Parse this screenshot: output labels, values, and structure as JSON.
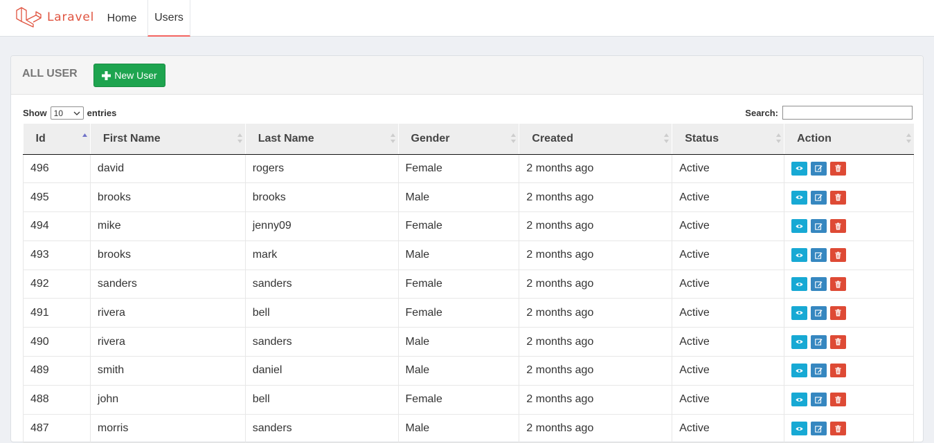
{
  "navbar": {
    "brand": "Laravel",
    "items": [
      {
        "label": "Home",
        "active": false
      },
      {
        "label": "Users",
        "active": true
      }
    ]
  },
  "panel": {
    "title": "ALL USER",
    "new_button": "New User"
  },
  "table_controls": {
    "show_label": "Show",
    "entries_value": "10",
    "entries_label": "entries",
    "search_label": "Search:",
    "search_value": ""
  },
  "table": {
    "columns": [
      "Id",
      "First Name",
      "Last Name",
      "Gender",
      "Created",
      "Status",
      "Action"
    ],
    "sorted_column": "Id",
    "rows": [
      {
        "id": "496",
        "first": "david",
        "last": "rogers",
        "gender": "Female",
        "created": "2 months ago",
        "status": "Active"
      },
      {
        "id": "495",
        "first": "brooks",
        "last": "brooks",
        "gender": "Male",
        "created": "2 months ago",
        "status": "Active"
      },
      {
        "id": "494",
        "first": "mike",
        "last": "jenny09",
        "gender": "Female",
        "created": "2 months ago",
        "status": "Active"
      },
      {
        "id": "493",
        "first": "brooks",
        "last": "mark",
        "gender": "Male",
        "created": "2 months ago",
        "status": "Active"
      },
      {
        "id": "492",
        "first": "sanders",
        "last": "sanders",
        "gender": "Female",
        "created": "2 months ago",
        "status": "Active"
      },
      {
        "id": "491",
        "first": "rivera",
        "last": "bell",
        "gender": "Female",
        "created": "2 months ago",
        "status": "Active"
      },
      {
        "id": "490",
        "first": "rivera",
        "last": "sanders",
        "gender": "Male",
        "created": "2 months ago",
        "status": "Active"
      },
      {
        "id": "489",
        "first": "smith",
        "last": "daniel",
        "gender": "Male",
        "created": "2 months ago",
        "status": "Active"
      },
      {
        "id": "488",
        "first": "john",
        "last": "bell",
        "gender": "Female",
        "created": "2 months ago",
        "status": "Active"
      },
      {
        "id": "487",
        "first": "morris",
        "last": "sanders",
        "gender": "Male",
        "created": "2 months ago",
        "status": "Active"
      }
    ]
  },
  "icons": {
    "brand": "laravel-logo-icon",
    "new": "plus-icon",
    "view": "eye-icon",
    "edit": "edit-icon",
    "delete": "trash-icon",
    "sort": "sort-arrows-icon"
  },
  "colors": {
    "brand": "#e0533f",
    "new_button": "#1ea44f",
    "view_button": "#17a9d4",
    "edit_button": "#3687c0",
    "delete_button": "#de4a35",
    "nav_active_underline": "#f4645f"
  }
}
